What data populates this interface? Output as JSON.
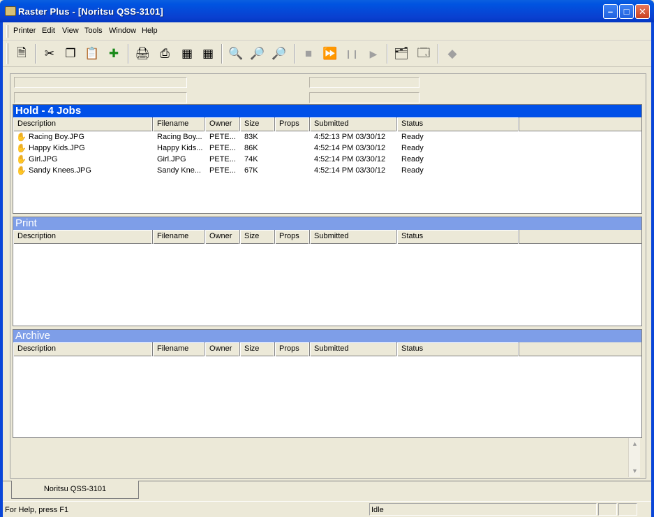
{
  "window": {
    "title": "Raster Plus - [Noritsu QSS-3101]",
    "minimize_glyph": "–",
    "maximize_glyph": "□",
    "close_glyph": "✕"
  },
  "menu": [
    "Printer",
    "Edit",
    "View",
    "Tools",
    "Window",
    "Help"
  ],
  "toolbar": {
    "icons": [
      "new-job-icon",
      "cut-icon",
      "copy-icon",
      "paste-icon",
      "add-job-icon",
      "print-icon",
      "print-setup-icon",
      "layout-single-icon",
      "layout-multi-icon",
      "zoom-icon",
      "zoom-in-icon",
      "zoom-out-icon",
      "stop-icon",
      "fast-forward-icon",
      "pause-icon",
      "play-icon",
      "properties-icon",
      "settings-icon",
      "eraser-icon"
    ],
    "glyphs": {
      "new": "🗎",
      "cut": "✂",
      "copy": "❐",
      "paste": "📋",
      "add": "✚",
      "print": "🖨",
      "print_setup": "⎙",
      "layout_single": "▦",
      "layout_multi": "▦",
      "zoom": "🔍",
      "zoom_in": "🔎",
      "zoom_out": "🔎",
      "stop": "■",
      "ff": "⏩",
      "pause": "❙❙",
      "play": "▶",
      "props": "🗂",
      "settings": "🗔",
      "eraser": "◆"
    }
  },
  "columns": [
    "Description",
    "Filename",
    "Owner",
    "Size",
    "Props",
    "Submitted",
    "Status"
  ],
  "queues": {
    "hold": {
      "title": "Hold - 4 Jobs",
      "jobs": [
        {
          "description": "Racing Boy.JPG",
          "filename": "Racing Boy...",
          "owner": "PETE...",
          "size": "83K",
          "props": "",
          "submitted": "4:52:13 PM 03/30/12",
          "status": "Ready"
        },
        {
          "description": "Happy Kids.JPG",
          "filename": "Happy Kids...",
          "owner": "PETE...",
          "size": "86K",
          "props": "",
          "submitted": "4:52:14 PM 03/30/12",
          "status": "Ready"
        },
        {
          "description": "Girl.JPG",
          "filename": "Girl.JPG",
          "owner": "PETE...",
          "size": "74K",
          "props": "",
          "submitted": "4:52:14 PM 03/30/12",
          "status": "Ready"
        },
        {
          "description": "Sandy Knees.JPG",
          "filename": "Sandy Kne...",
          "owner": "PETE...",
          "size": "67K",
          "props": "",
          "submitted": "4:52:14 PM 03/30/12",
          "status": "Ready"
        }
      ]
    },
    "print": {
      "title": "Print"
    },
    "archive": {
      "title": "Archive"
    }
  },
  "job_icon": "✋",
  "scroll": {
    "up": "▲",
    "down": "▼"
  },
  "tab": {
    "label": "Noritsu QSS-3101"
  },
  "status": {
    "help": "For Help, press F1",
    "state": "Idle"
  },
  "colors": {
    "active_header": "#0050e8",
    "inactive_header": "#7e9ee8",
    "titlebar": "#0054e3"
  }
}
